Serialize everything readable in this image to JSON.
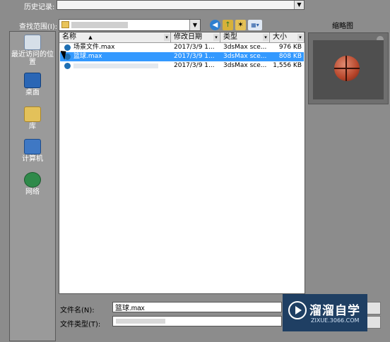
{
  "history": {
    "label": "历史记录:"
  },
  "look_in": {
    "label": "查找范围(I):",
    "value": ""
  },
  "thumbnail": {
    "label": "缩略图"
  },
  "places": [
    {
      "name": "recent",
      "label": "最近访问的位置",
      "icon": "recent-places-icon"
    },
    {
      "name": "desktop",
      "label": "桌面",
      "icon": "desktop-icon"
    },
    {
      "name": "libraries",
      "label": "库",
      "icon": "library-folder-icon"
    },
    {
      "name": "computer",
      "label": "计算机",
      "icon": "computer-icon"
    },
    {
      "name": "network",
      "label": "网络",
      "icon": "network-icon"
    }
  ],
  "file_list": {
    "columns": [
      "名称",
      "修改日期",
      "类型",
      "大小"
    ],
    "rows": [
      {
        "name": "场景文件.max",
        "date": "2017/3/9 1...",
        "type": "3dsMax sce...",
        "size": "976 KB",
        "selected": false
      },
      {
        "name": "篮球.max",
        "date": "2017/3/9 1...",
        "type": "3dsMax sce...",
        "size": "808 KB",
        "selected": true
      },
      {
        "name": "",
        "date": "2017/3/9 1...",
        "type": "3dsMax sce...",
        "size": "1,556 KB",
        "selected": false
      }
    ]
  },
  "file_name": {
    "label": "文件名(N):",
    "value": "篮球.max"
  },
  "file_type": {
    "label": "文件类型(T):",
    "value": ""
  },
  "watermark": {
    "name": "溜溜自学",
    "url": "ZIXUE.3066.COM"
  },
  "colors": {
    "selection": "#3399ff",
    "dialog_bg": "#8c8c8c",
    "watermark_bg": "#163860"
  }
}
